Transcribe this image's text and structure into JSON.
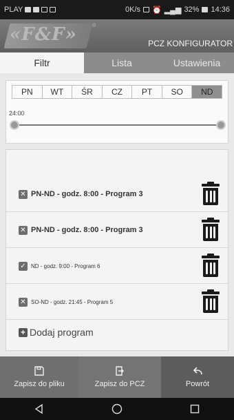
{
  "status_bar": {
    "carrier": "PLAY",
    "network_speed": "0K/s",
    "battery": "32%",
    "time": "14:36"
  },
  "header": {
    "logo_text": "«F&F»",
    "logo_reg": "®",
    "title": "PCZ KONFIGURATOR"
  },
  "tabs": [
    {
      "label": "Filtr",
      "active": true
    },
    {
      "label": "Lista",
      "active": false
    },
    {
      "label": "Ustawienia",
      "active": false
    }
  ],
  "filter": {
    "days": [
      "PN",
      "WT",
      "ŚR",
      "CZ",
      "PT",
      "SO",
      "ND"
    ],
    "selected_day": "ND",
    "time_label": "24:00"
  },
  "programs": [
    {
      "label": "PN-ND - godz. 8:00 - Program 3",
      "state": "x",
      "style": "bold"
    },
    {
      "label": "PN-ND - godz. 8:00 - Program 3",
      "state": "x",
      "style": "bold"
    },
    {
      "label": "ND - godz. 9:00 - Program 6",
      "state": "check",
      "style": "small"
    },
    {
      "label": "SO-ND - godz. 21:45 - Program 5",
      "state": "x",
      "style": "small"
    }
  ],
  "add_program_label": "Dodaj program",
  "bottom_bar": {
    "save_file": "Zapisz do pliku",
    "save_pcz": "Zapisz do PCZ",
    "back": "Powrót"
  },
  "icons": {
    "row_remove": "x-box-icon",
    "row_checked": "check-box-icon",
    "delete": "trash-icon",
    "add": "plus-box-icon",
    "save_file": "floppy-disk-icon",
    "save_pcz": "export-icon",
    "back": "back-arrow-icon"
  }
}
